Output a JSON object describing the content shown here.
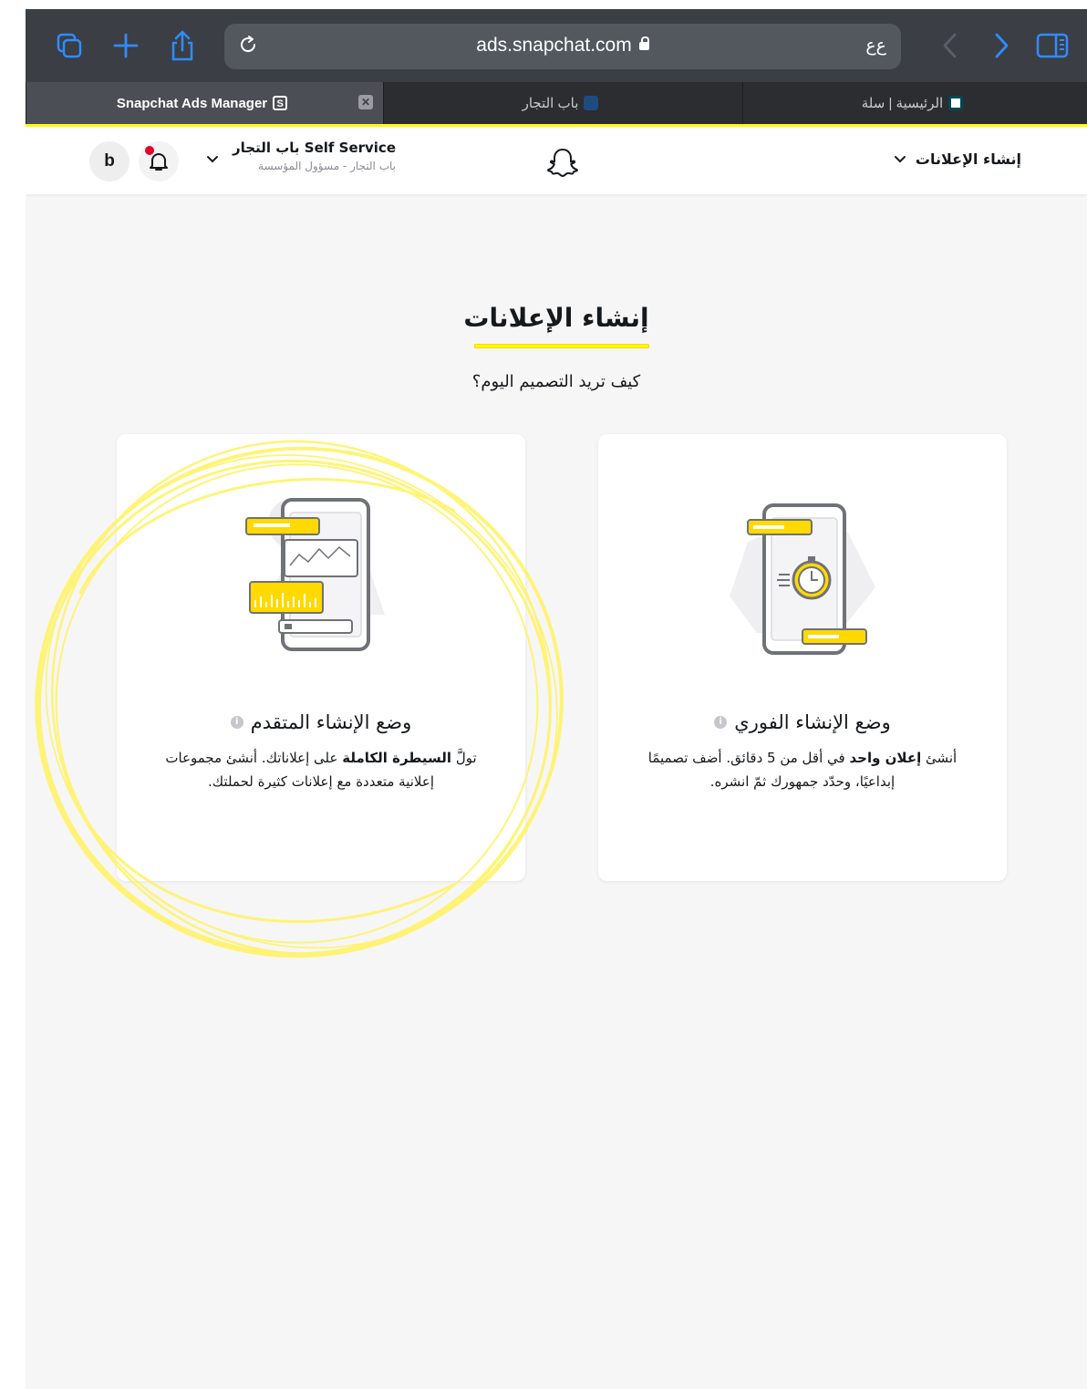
{
  "browser": {
    "url": "ads.snapchat.com",
    "reader_label": "ﻉﻉ",
    "tabs": [
      {
        "label": "Snapchat Ads Manager",
        "favicon_letter": "S",
        "active": true
      },
      {
        "label": "باب التجار",
        "active": false
      },
      {
        "label": "الرئيسية | سلة",
        "active": false
      }
    ]
  },
  "header": {
    "avatar_letter": "b",
    "account_name": "باب التجار Self Service",
    "account_sub": "باب التجار - مسؤول المؤسسة",
    "create_menu_label": "إنشاء الإعلانات"
  },
  "main": {
    "title": "إنشاء الإعلانات",
    "subtitle": "كيف تريد التصميم اليوم؟"
  },
  "cards": {
    "advanced": {
      "title": "وضع الإنشاء المتقدم",
      "desc_pre": "تولَّ ",
      "desc_bold": "السيطرة الكاملة",
      "desc_post": " على إعلاناتك. أنشئ مجموعات إعلانية متعددة مع إعلانات كثيرة لحملتك."
    },
    "instant": {
      "title": "وضع الإنشاء الفوري",
      "desc_pre": "أنشئ ",
      "desc_bold": "إعلان واحد",
      "desc_post": " في أقل من 5 دقائق. أضف تصميمًا إبداعيًا، وحدّد جمهورك ثمّ انشره."
    }
  },
  "colors": {
    "accent": "#fffc00",
    "toolbar": "#3b3e44",
    "tab_bar": "#2b2d31",
    "icon_blue": "#2f8cff",
    "notification": "#e3002b"
  }
}
